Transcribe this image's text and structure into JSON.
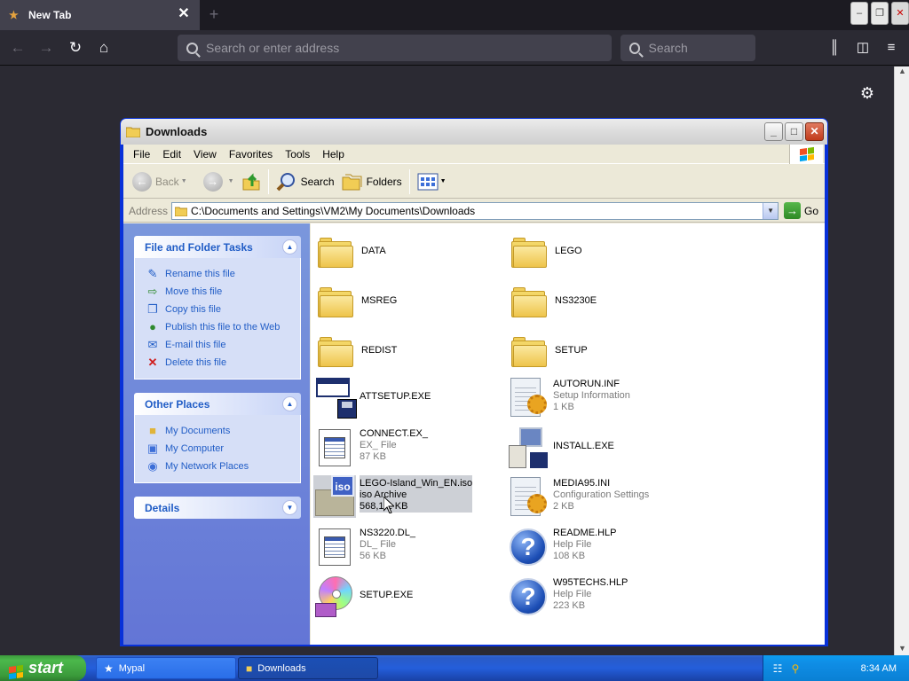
{
  "browser": {
    "tab_title": "New Tab",
    "url_placeholder": "Search or enter address",
    "search_placeholder": "Search"
  },
  "window": {
    "title": "Downloads",
    "menu": [
      "File",
      "Edit",
      "View",
      "Favorites",
      "Tools",
      "Help"
    ],
    "toolbar": {
      "back": "Back",
      "search": "Search",
      "folders": "Folders"
    },
    "address": {
      "label": "Address",
      "path": "C:\\Documents and Settings\\VM2\\My Documents\\Downloads",
      "go": "Go"
    }
  },
  "tasks": {
    "file_folder": {
      "title": "File and Folder Tasks",
      "items": [
        "Rename this file",
        "Move this file",
        "Copy this file",
        "Publish this file to the Web",
        "E-mail this file",
        "Delete this file"
      ]
    },
    "other_places": {
      "title": "Other Places",
      "items": [
        "My Documents",
        "My Computer",
        "My Network Places"
      ]
    },
    "details": {
      "title": "Details"
    }
  },
  "files": [
    {
      "name": "DATA",
      "type": "",
      "size": "",
      "icon": "folder"
    },
    {
      "name": "LEGO",
      "type": "",
      "size": "",
      "icon": "folder"
    },
    {
      "name": "MSREG",
      "type": "",
      "size": "",
      "icon": "folder"
    },
    {
      "name": "NS3230E",
      "type": "",
      "size": "",
      "icon": "folder"
    },
    {
      "name": "REDIST",
      "type": "",
      "size": "",
      "icon": "folder"
    },
    {
      "name": "SETUP",
      "type": "",
      "size": "",
      "icon": "folder"
    },
    {
      "name": "ATTSETUP.EXE",
      "type": "",
      "size": "",
      "icon": "setup-exe"
    },
    {
      "name": "AUTORUN.INF",
      "type": "Setup Information",
      "size": "1 KB",
      "icon": "ini-settings"
    },
    {
      "name": "CONNECT.EX_",
      "type": "EX_ File",
      "size": "87 KB",
      "icon": "generic-file"
    },
    {
      "name": "INSTALL.EXE",
      "type": "",
      "size": "",
      "icon": "install-exe"
    },
    {
      "name": "LEGO-Island_Win_EN.iso",
      "type": "iso Archive",
      "size": "568,1.2 KB",
      "icon": "iso-archive"
    },
    {
      "name": "MEDIA95.INI",
      "type": "Configuration Settings",
      "size": "2 KB",
      "icon": "ini-settings"
    },
    {
      "name": "NS3220.DL_",
      "type": "DL_ File",
      "size": "56 KB",
      "icon": "generic-file"
    },
    {
      "name": "README.HLP",
      "type": "Help File",
      "size": "108 KB",
      "icon": "help"
    },
    {
      "name": "SETUP.EXE",
      "type": "",
      "size": "",
      "icon": "cd-setup"
    },
    {
      "name": "W95TECHS.HLP",
      "type": "Help File",
      "size": "223 KB",
      "icon": "help"
    }
  ],
  "taskbar": {
    "start": "start",
    "items": [
      "Mypal",
      "Downloads"
    ],
    "clock": "8:34 AM"
  }
}
